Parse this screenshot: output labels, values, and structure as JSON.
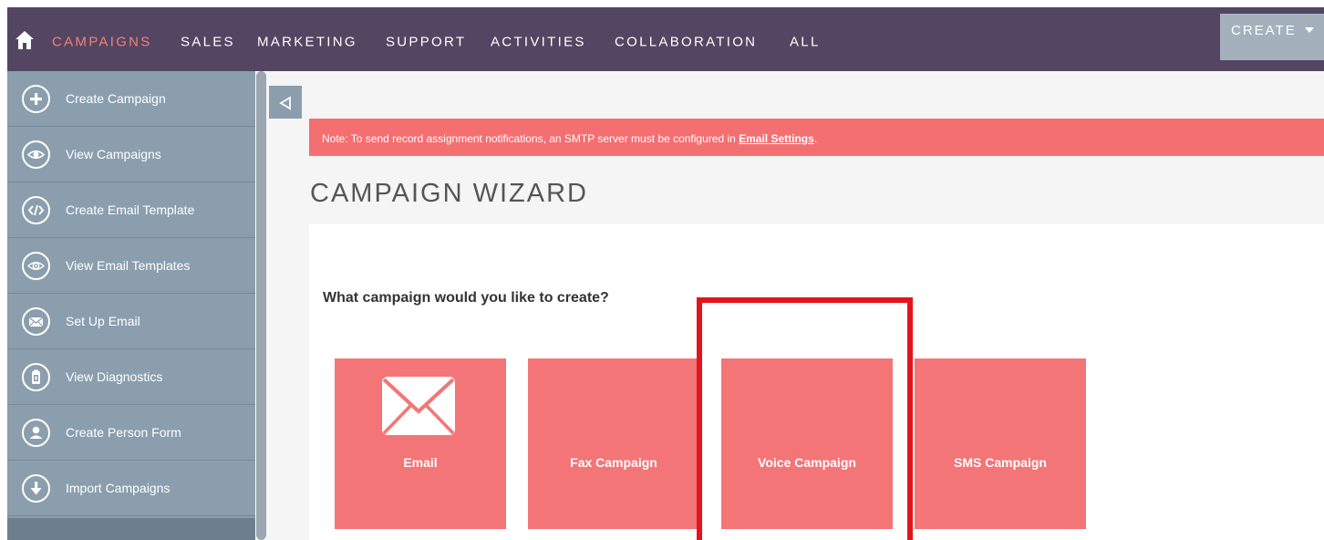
{
  "topnav": {
    "items": [
      "CAMPAIGNS",
      "SALES",
      "MARKETING",
      "SUPPORT",
      "ACTIVITIES",
      "COLLABORATION",
      "ALL"
    ],
    "active": "CAMPAIGNS",
    "create_label": "CREATE"
  },
  "sidebar": {
    "items": [
      {
        "label": "Create Campaign",
        "icon": "plus-icon"
      },
      {
        "label": "View Campaigns",
        "icon": "eye-icon"
      },
      {
        "label": "Create Email Template",
        "icon": "code-icon"
      },
      {
        "label": "View Email Templates",
        "icon": "email-eye-icon"
      },
      {
        "label": "Set Up Email",
        "icon": "envelope-icon"
      },
      {
        "label": "View Diagnostics",
        "icon": "diagnostics-icon"
      },
      {
        "label": "Create Person Form",
        "icon": "person-icon"
      },
      {
        "label": "Import Campaigns",
        "icon": "arrow-down-icon"
      }
    ]
  },
  "notice": {
    "text": "Note: To send record assignment notifications, an SMTP server must be configured in ",
    "link": "Email Settings",
    "suffix": "."
  },
  "page": {
    "title": "CAMPAIGN WIZARD",
    "question": "What campaign would you like to create?"
  },
  "tiles": [
    {
      "label": "Email",
      "icon": "envelope-icon"
    },
    {
      "label": "Fax Campaign"
    },
    {
      "label": "Voice Campaign"
    },
    {
      "label": "SMS Campaign"
    }
  ],
  "colors": {
    "topbar": "#544562",
    "active_nav": "#f08377",
    "sidebar": "#8b9eae",
    "notice": "#f46f72",
    "tile": "#f47577",
    "highlight": "#e3141c"
  }
}
